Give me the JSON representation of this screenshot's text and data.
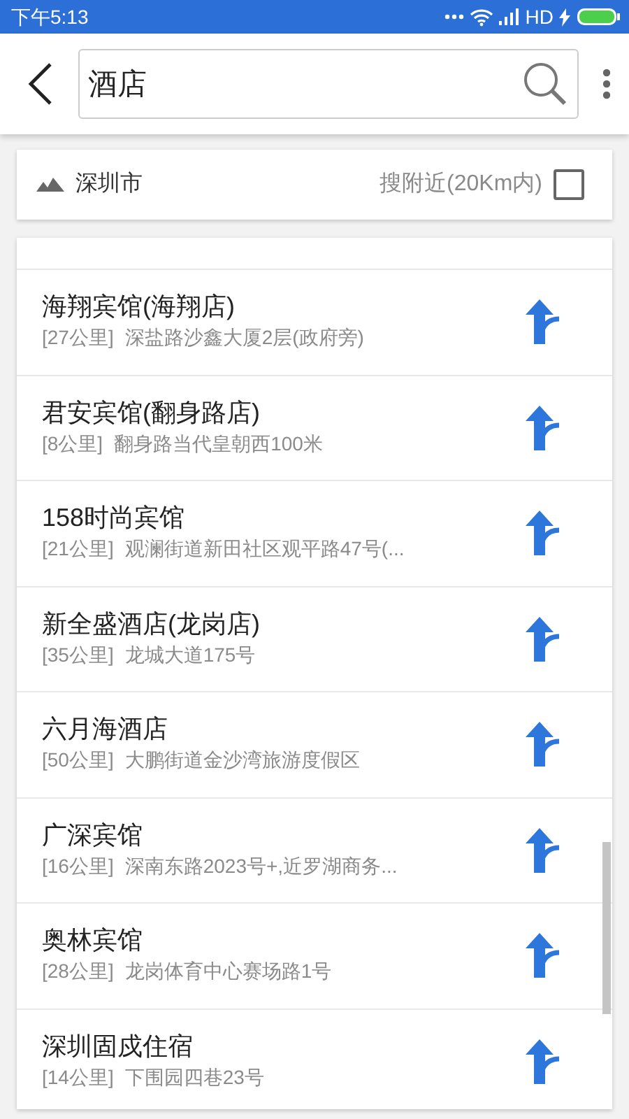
{
  "status_bar": {
    "time": "下午5:13",
    "network": "HD"
  },
  "search": {
    "value": "酒店"
  },
  "filter": {
    "city": "深圳市",
    "nearby_label": "搜附近(20Km内)",
    "nearby_checked": false
  },
  "results": [
    {
      "name": "海翔宾馆(海翔店)",
      "distance": "[27公里]",
      "address": "深盐路沙鑫大厦2层(政府旁)"
    },
    {
      "name": "君安宾馆(翻身路店)",
      "distance": "[8公里]",
      "address": "翻身路当代皇朝西100米"
    },
    {
      "name": "158时尚宾馆",
      "distance": "[21公里]",
      "address": "观澜街道新田社区观平路47号(..."
    },
    {
      "name": "新全盛酒店(龙岗店)",
      "distance": "[35公里]",
      "address": "龙城大道175号"
    },
    {
      "name": "六月海酒店",
      "distance": "[50公里]",
      "address": "大鹏街道金沙湾旅游度假区"
    },
    {
      "name": "广深宾馆",
      "distance": "[16公里]",
      "address": "深南东路2023号+,近罗湖商务..."
    },
    {
      "name": "奥林宾馆",
      "distance": "[28公里]",
      "address": "龙岗体育中心赛场路1号"
    },
    {
      "name": "深圳固戍住宿",
      "distance": "[14公里]",
      "address": "下围园四巷23号"
    }
  ]
}
